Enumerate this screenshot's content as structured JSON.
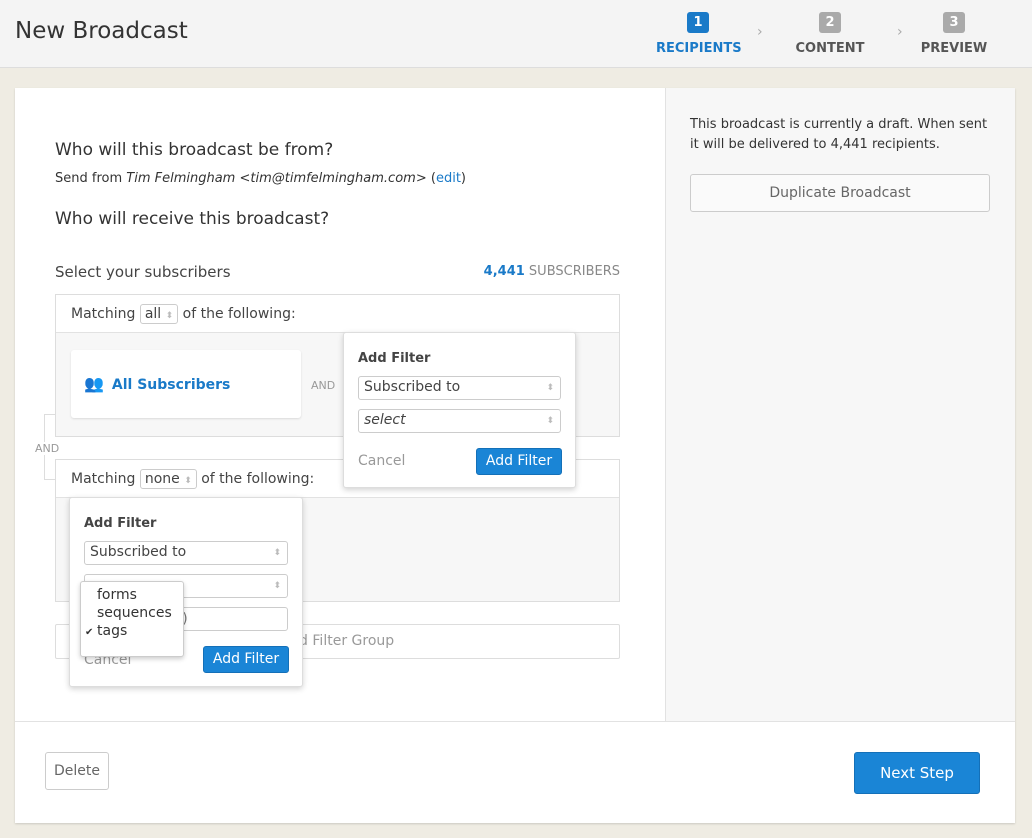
{
  "header": {
    "title": "New Broadcast",
    "steps": [
      {
        "num": "1",
        "label": "RECIPIENTS",
        "active": true
      },
      {
        "num": "2",
        "label": "CONTENT"
      },
      {
        "num": "3",
        "label": "PREVIEW"
      }
    ]
  },
  "from": {
    "heading": "Who will this broadcast be from?",
    "prefix": "Send from ",
    "sender": "Tim Felmingham <tim@timfelmingham.com>",
    "edit_open": " (",
    "edit": "edit",
    "edit_close": ")"
  },
  "receive": {
    "heading": "Who will receive this broadcast?"
  },
  "subscribers": {
    "label": "Select your subscribers",
    "count": "4,441",
    "count_suffix": " SUBSCRIBERS"
  },
  "group1": {
    "matching": "Matching",
    "value": "all",
    "suffix": "of the following:",
    "card": "All Subscribers",
    "and": "AND"
  },
  "between_and": "AND",
  "group2": {
    "matching": "Matching",
    "value": "none",
    "suffix": "of the following:"
  },
  "add_group": "Add Filter Group",
  "popup1": {
    "title": "Add Filter",
    "type": "Subscribed to",
    "value": "select",
    "cancel": "Cancel",
    "submit": "Add Filter"
  },
  "popup2": {
    "title": "Add Filter",
    "type": "Subscribed to",
    "search_placeholder": "(type to filter)",
    "cancel": "Cancel",
    "submit": "Add Filter",
    "options": [
      "forms",
      "sequences",
      "tags"
    ],
    "selected": "tags"
  },
  "sidebar": {
    "status": "This broadcast is currently a draft. When sent it will be delivered to 4,441 recipients.",
    "duplicate": "Duplicate Broadcast"
  },
  "footer": {
    "delete": "Delete",
    "next": "Next Step"
  },
  "colors": {
    "accent": "#1a85d6",
    "link": "#1a7ac8"
  }
}
